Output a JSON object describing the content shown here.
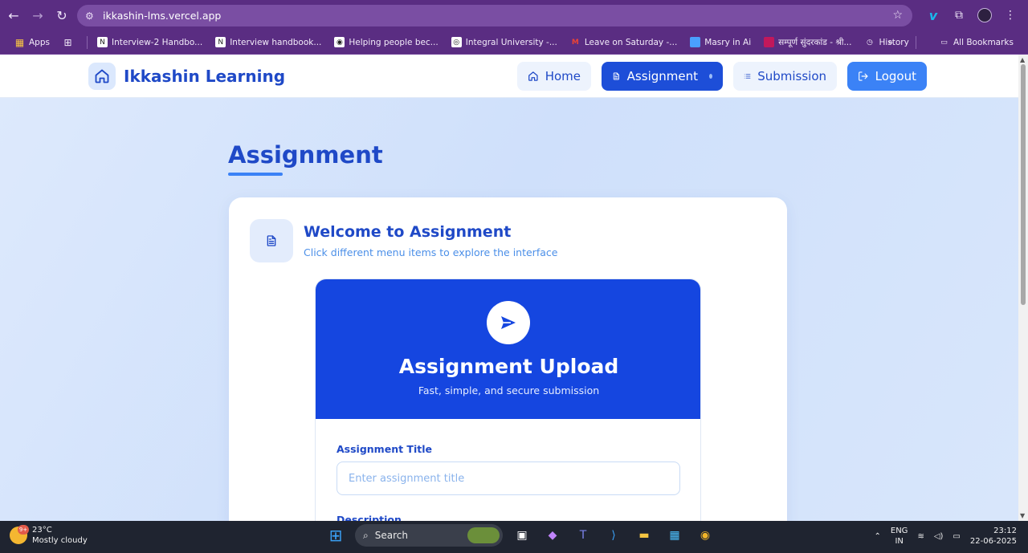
{
  "browser": {
    "url": "ikkashin-lms.vercel.app",
    "bookmarks": [
      {
        "label": "Apps",
        "icon": "apps-grid-icon"
      },
      {
        "label": "Interview-2 Handbo...",
        "icon": "notion-icon"
      },
      {
        "label": "Interview handbook...",
        "icon": "notion-icon"
      },
      {
        "label": "Helping people bec...",
        "icon": "site-icon"
      },
      {
        "label": "Integral University -...",
        "icon": "site-icon"
      },
      {
        "label": "Leave on Saturday -...",
        "icon": "gmail-icon"
      },
      {
        "label": "Masry in Ai",
        "icon": "site-icon"
      },
      {
        "label": "सम्पूर्ण सुंदरकांड - श्री...",
        "icon": "site-icon"
      },
      {
        "label": "History",
        "icon": "history-icon"
      }
    ],
    "all_bookmarks": "All Bookmarks"
  },
  "header": {
    "brand": "Ikkashin Learning",
    "nav": {
      "home": "Home",
      "assignment": "Assignment",
      "submission": "Submission",
      "logout": "Logout"
    }
  },
  "page": {
    "title": "Assignment",
    "welcome_title": "Welcome to Assignment",
    "welcome_sub": "Click different menu items to explore the interface"
  },
  "upload": {
    "title": "Assignment Upload",
    "subtitle": "Fast, simple, and secure submission",
    "title_label": "Assignment Title",
    "title_placeholder": "Enter assignment title",
    "title_value": "",
    "description_label": "Description"
  },
  "taskbar": {
    "temp": "23°C",
    "weather": "Mostly cloudy",
    "weather_badge": "9+",
    "search": "Search",
    "lang": "ENG",
    "region": "IN",
    "time": "23:12",
    "date": "22-06-2025"
  },
  "colors": {
    "primary": "#1d4ed8",
    "hero": "#1546e0",
    "accent": "#3b82f6",
    "chrome": "#5a2d82"
  }
}
